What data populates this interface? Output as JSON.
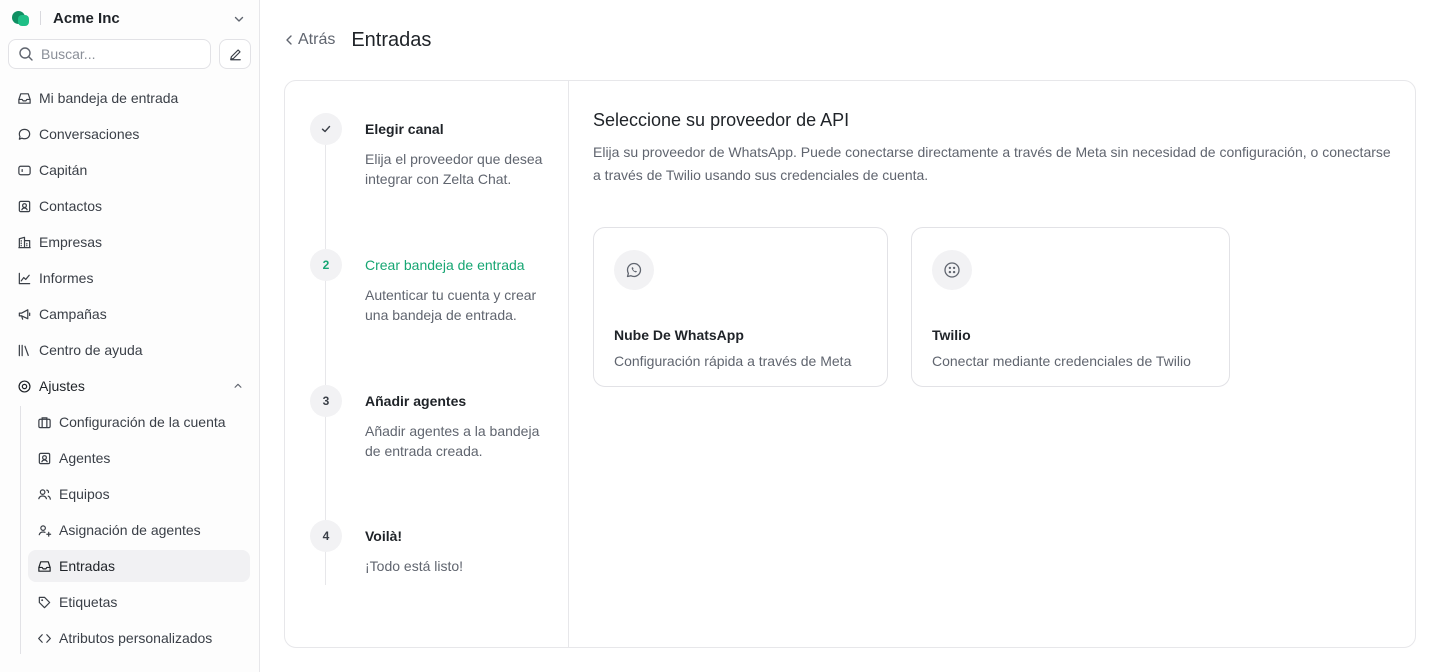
{
  "sidebar": {
    "account_name": "Acme Inc",
    "search_placeholder": "Buscar...",
    "nav": [
      {
        "label": "Mi bandeja de entrada",
        "icon": "inbox-icon"
      },
      {
        "label": "Conversaciones",
        "icon": "chat-icon"
      },
      {
        "label": "Capitán",
        "icon": "captain-icon"
      },
      {
        "label": "Contactos",
        "icon": "contacts-icon"
      },
      {
        "label": "Empresas",
        "icon": "building-icon"
      },
      {
        "label": "Informes",
        "icon": "chart-icon"
      },
      {
        "label": "Campañas",
        "icon": "megaphone-icon"
      },
      {
        "label": "Centro de ayuda",
        "icon": "library-icon"
      }
    ],
    "settings": {
      "label": "Ajustes",
      "icon": "settings-icon",
      "items": [
        {
          "label": "Configuración de la cuenta",
          "icon": "briefcase-icon"
        },
        {
          "label": "Agentes",
          "icon": "agent-icon"
        },
        {
          "label": "Equipos",
          "icon": "team-icon"
        },
        {
          "label": "Asignación de agentes",
          "icon": "assign-icon"
        },
        {
          "label": "Entradas",
          "icon": "inbox-icon",
          "active": true
        },
        {
          "label": "Etiquetas",
          "icon": "tag-icon"
        },
        {
          "label": "Atributos personalizados",
          "icon": "code-icon"
        }
      ]
    }
  },
  "header": {
    "back_label": "Atrás",
    "title": "Entradas"
  },
  "steps": [
    {
      "number": "",
      "title": "Elegir canal",
      "description": "Elija el proveedor que desea integrar con Zelta Chat.",
      "state": "done"
    },
    {
      "number": "2",
      "title": "Crear bandeja de entrada",
      "description": "Autenticar tu cuenta y crear una bandeja de entrada.",
      "state": "active"
    },
    {
      "number": "3",
      "title": "Añadir agentes",
      "description": "Añadir agentes a la bandeja de entrada creada.",
      "state": "pending"
    },
    {
      "number": "4",
      "title": "Voilà!",
      "description": "¡Todo está listo!",
      "state": "pending"
    }
  ],
  "content": {
    "heading": "Seleccione su proveedor de API",
    "description": "Elija su proveedor de WhatsApp. Puede conectarse directamente a través de Meta sin necesidad de configuración, o conectarse a través de Twilio usando sus credenciales de cuenta.",
    "providers": [
      {
        "title": "Nube De WhatsApp",
        "description": "Configuración rápida a través de Meta",
        "icon": "whatsapp-icon"
      },
      {
        "title": "Twilio",
        "description": "Conectar mediante credenciales de Twilio",
        "icon": "twilio-icon"
      }
    ]
  },
  "colors": {
    "accent": "#17a673",
    "active_bg": "#f1f1f3",
    "border": "#e7e7ea"
  }
}
